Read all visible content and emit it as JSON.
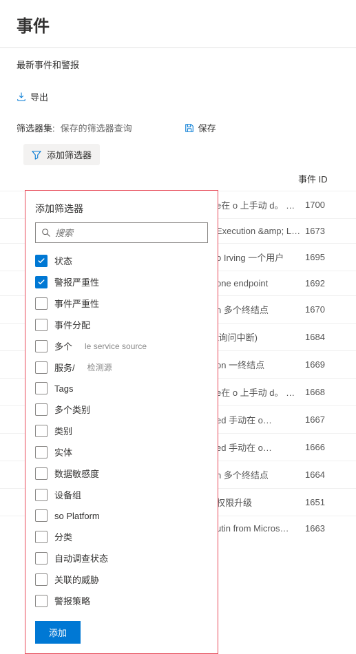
{
  "page": {
    "title": "事件",
    "subheader": "最新事件和警报"
  },
  "toolbar": {
    "export_label": "导出"
  },
  "filter_bar": {
    "set_label": "筛选器集:",
    "query_label": "保存的筛选器查询",
    "save_label": "保存",
    "add_filter_label": "添加筛选器"
  },
  "table": {
    "header_id": "事件 ID",
    "rows": [
      {
        "name": "e在 o 上手动 d。 …",
        "id": "1700"
      },
      {
        "name": "Execution &amp; Late…",
        "id": "1673"
      },
      {
        "name": "o Irving 一个用户",
        "id": "1695"
      },
      {
        "name": "one endpoint",
        "id": "1692"
      },
      {
        "name": "n 多个终结点",
        "id": "1670"
      },
      {
        "name": "t询问中断)",
        "id": "1684"
      },
      {
        "name": "on 一终结点",
        "id": "1669"
      },
      {
        "name": "e在 o 上手动 d。 …",
        "id": "1668"
      },
      {
        "name": "ed 手动在 o…",
        "id": "1667"
      },
      {
        "name": "ed 手动在 o…",
        "id": "1666"
      },
      {
        "name": "n 多个终结点",
        "id": "1664"
      },
      {
        "name": "权限升级",
        "id": "1651"
      },
      {
        "name": "utin from Micros…",
        "id": "1663"
      }
    ]
  },
  "filter_panel": {
    "title": "添加筛选器",
    "search_placeholder": "搜索",
    "add_button": "添加",
    "items": [
      {
        "label": "状态",
        "checked": true
      },
      {
        "label": "警报严重性",
        "checked": true
      },
      {
        "label": "事件严重性",
        "checked": false
      },
      {
        "label": "事件分配",
        "checked": false
      },
      {
        "label": "多个",
        "sublabel": "le service source",
        "checked": false
      },
      {
        "label": "服务/",
        "sublabel": "检测源",
        "checked": false
      },
      {
        "label": "Tags",
        "checked": false
      },
      {
        "label": "多个类别",
        "checked": false
      },
      {
        "label": "类别",
        "checked": false
      },
      {
        "label": "实体",
        "checked": false
      },
      {
        "label": "数据敏感度",
        "checked": false
      },
      {
        "label": "设备组",
        "checked": false
      },
      {
        "label": "so Platform",
        "checked": false
      },
      {
        "label": "分类",
        "checked": false
      },
      {
        "label": "自动调查状态",
        "checked": false
      },
      {
        "label": "关联的威胁",
        "checked": false
      },
      {
        "label": "警报策略",
        "checked": false
      }
    ]
  }
}
